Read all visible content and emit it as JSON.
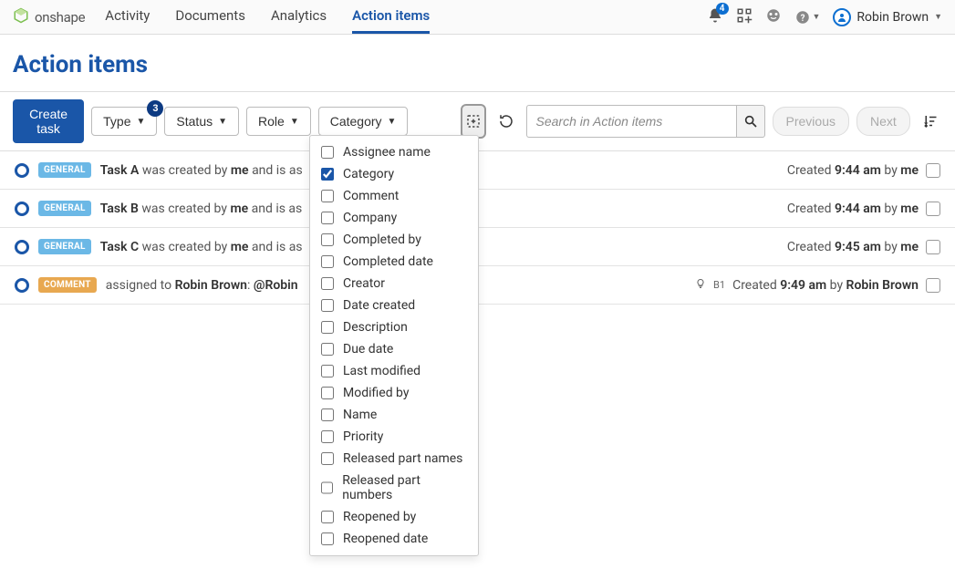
{
  "header": {
    "logo_text": "onshape",
    "tabs": [
      "Activity",
      "Documents",
      "Analytics",
      "Action items"
    ],
    "active_tab": 3,
    "notif_count": "4",
    "user_name": "Robin Brown"
  },
  "page_title": "Action items",
  "toolbar": {
    "create_task": "Create task",
    "filters": [
      {
        "label": "Type",
        "badge": "3"
      },
      {
        "label": "Status"
      },
      {
        "label": "Role"
      },
      {
        "label": "Category"
      }
    ],
    "search_placeholder": "Search in Action items",
    "prev": "Previous",
    "next": "Next"
  },
  "dropdown": {
    "items": [
      {
        "label": "Assignee name",
        "checked": false
      },
      {
        "label": "Category",
        "checked": true
      },
      {
        "label": "Comment",
        "checked": false
      },
      {
        "label": "Company",
        "checked": false
      },
      {
        "label": "Completed by",
        "checked": false
      },
      {
        "label": "Completed date",
        "checked": false
      },
      {
        "label": "Creator",
        "checked": false
      },
      {
        "label": "Date created",
        "checked": false
      },
      {
        "label": "Description",
        "checked": false
      },
      {
        "label": "Due date",
        "checked": false
      },
      {
        "label": "Last modified",
        "checked": false
      },
      {
        "label": "Modified by",
        "checked": false
      },
      {
        "label": "Name",
        "checked": false
      },
      {
        "label": "Priority",
        "checked": false
      },
      {
        "label": "Released part names",
        "checked": false
      },
      {
        "label": "Released part numbers",
        "checked": false
      },
      {
        "label": "Reopened by",
        "checked": false
      },
      {
        "label": "Reopened date",
        "checked": false
      }
    ]
  },
  "rows": [
    {
      "tag": "GENERAL",
      "tag_class": "tag-general",
      "task": "Task A",
      "verb": " was created by ",
      "actor": "me",
      "suffix": " and is as",
      "created_label": "Created ",
      "time": "9:44 am",
      "by_label": " by ",
      "by": "me"
    },
    {
      "tag": "GENERAL",
      "tag_class": "tag-general",
      "task": "Task B",
      "verb": " was created by ",
      "actor": "me",
      "suffix": " and is as",
      "created_label": "Created ",
      "time": "9:44 am",
      "by_label": " by ",
      "by": "me"
    },
    {
      "tag": "GENERAL",
      "tag_class": "tag-general",
      "task": "Task C",
      "verb": " was created by ",
      "actor": "me",
      "suffix": " and is as",
      "created_label": "Created ",
      "time": "9:45 am",
      "by_label": " by ",
      "by": "me"
    },
    {
      "tag": "COMMENT",
      "tag_class": "tag-comment",
      "prefix": "assigned to ",
      "assignee": "Robin Brown",
      "colon": ":  ",
      "mention": "@Robin",
      "b1": "B1",
      "created_label": "Created ",
      "time": "9:49 am",
      "by_label": " by ",
      "by": "Robin Brown"
    }
  ]
}
